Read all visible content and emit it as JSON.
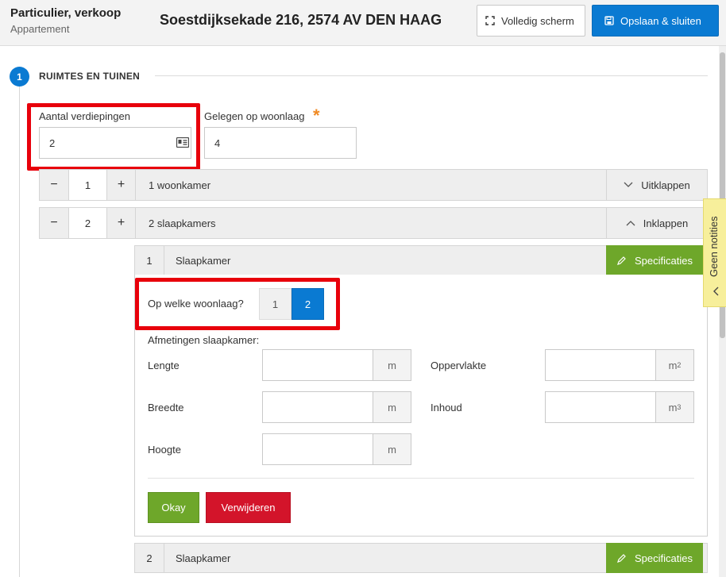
{
  "header": {
    "listing_type": "Particulier, verkoop",
    "property_type": "Appartement",
    "address": "Soestdijksekade 216, 2574 AV DEN HAAG",
    "fullscreen_label": "Volledig scherm",
    "save_close_label": "Opslaan & sluiten"
  },
  "section": {
    "number": "1",
    "title": "RUIMTES EN TUINEN"
  },
  "floors": {
    "label": "Aantal verdiepingen",
    "value": "2"
  },
  "level": {
    "label": "Gelegen op woonlaag",
    "required_mark": "*",
    "value": "4"
  },
  "rooms": [
    {
      "minus": "−",
      "count": "1",
      "plus": "+",
      "label": "1 woonkamer",
      "toggle_label": "Uitklappen"
    },
    {
      "minus": "−",
      "count": "2",
      "plus": "+",
      "label": "2 slaapkamers",
      "toggle_label": "Inklappen"
    }
  ],
  "bedroom1": {
    "index": "1",
    "name": "Slaapkamer",
    "spec_label": "Specificaties",
    "floor_question": "Op welke woonlaag?",
    "floor_options": [
      "1",
      "2"
    ],
    "floor_selected": "2",
    "dims_title": "Afmetingen slaapkamer:",
    "fields": {
      "length": {
        "label": "Lengte",
        "unit": "m"
      },
      "width": {
        "label": "Breedte",
        "unit": "m"
      },
      "height": {
        "label": "Hoogte",
        "unit": "m"
      },
      "area": {
        "label": "Oppervlakte",
        "unit": "m",
        "sup": "2"
      },
      "volume": {
        "label": "Inhoud",
        "unit": "m",
        "sup": "3"
      }
    },
    "ok_label": "Okay",
    "delete_label": "Verwijderen"
  },
  "bedroom2": {
    "index": "2",
    "name": "Slaapkamer",
    "spec_label": "Specificaties"
  },
  "notes": {
    "label": "Geen notities"
  },
  "colors": {
    "accent_blue": "#0a7ad2",
    "spec_green": "#6ea72a",
    "delete_red": "#d3142a",
    "highlight_red": "#e8000b",
    "required_orange": "#f08a24",
    "notes_yellow": "#f7ef9b"
  }
}
